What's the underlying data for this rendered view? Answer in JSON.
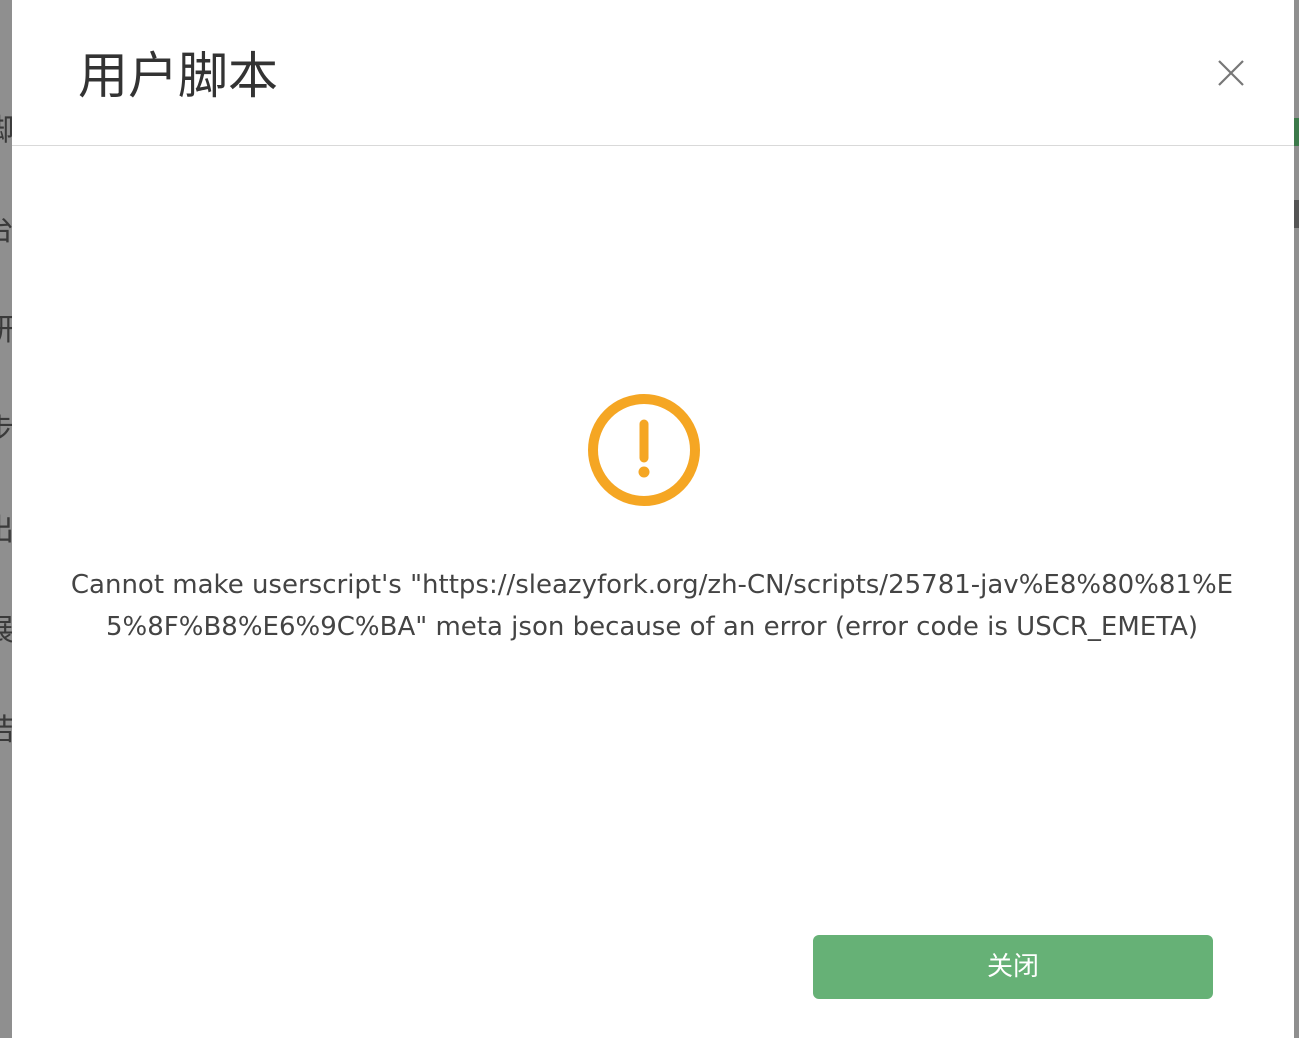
{
  "dialog": {
    "title": "用户脚本",
    "message": "Cannot make userscript's \"https://sleazyfork.org/zh-CN/scripts/25781-jav%E8%80%81%E5%8F%B8%E6%9C%BA\" meta json because of an error (error code is USCR_EMETA)",
    "close_button_label": "关闭",
    "close_icon": "close-icon",
    "status_icon": "warning-icon"
  },
  "colors": {
    "warning": "#f5a623",
    "button": "#66b176"
  }
}
